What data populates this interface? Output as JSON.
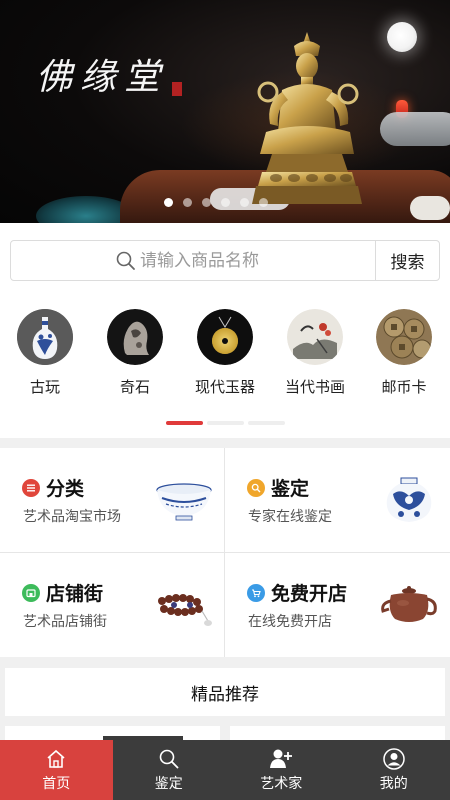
{
  "banner": {
    "title": "佛缘堂",
    "dots_count": 6,
    "active_dot": 0
  },
  "search": {
    "placeholder": "请输入商品名称",
    "button_label": "搜索"
  },
  "categories": [
    {
      "label": "古玩",
      "icon": "vase-icon"
    },
    {
      "label": "奇石",
      "icon": "rock-icon"
    },
    {
      "label": "现代玉器",
      "icon": "jade-pendant-icon"
    },
    {
      "label": "当代书画",
      "icon": "painting-icon"
    },
    {
      "label": "邮币卡",
      "icon": "coins-icon"
    }
  ],
  "category_pager": {
    "pages": 3,
    "active": 0
  },
  "features": [
    {
      "title": "分类",
      "subtitle": "艺术品淘宝市场",
      "badge_color": "#e0463b",
      "icon": "list-icon",
      "image": "porcelain-bowl-icon"
    },
    {
      "title": "鉴定",
      "subtitle": "专家在线鉴定",
      "badge_color": "#f0a62b",
      "icon": "magnifier-icon",
      "image": "porcelain-jar-icon"
    },
    {
      "title": "店铺街",
      "subtitle": "艺术品店铺街",
      "badge_color": "#3dbb5b",
      "icon": "shop-icon",
      "image": "bead-bracelet-icon"
    },
    {
      "title": "免费开店",
      "subtitle": "在线免费开店",
      "badge_color": "#3a9be6",
      "icon": "cart-icon",
      "image": "teapot-icon"
    }
  ],
  "recommend": {
    "title": "精品推荐"
  },
  "tabbar": [
    {
      "label": "首页",
      "icon": "home-icon",
      "active": true
    },
    {
      "label": "鉴定",
      "icon": "search-icon",
      "active": false
    },
    {
      "label": "艺术家",
      "icon": "add-user-icon",
      "active": false
    },
    {
      "label": "我的",
      "icon": "profile-icon",
      "active": false
    }
  ],
  "colors": {
    "accent": "#d8423e",
    "tabbar_bg": "#3c3c3c"
  }
}
